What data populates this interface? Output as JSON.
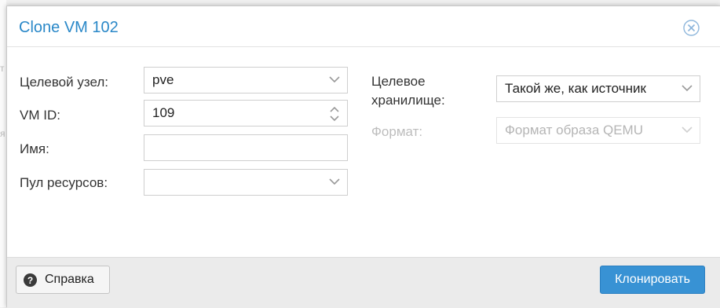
{
  "background": {
    "glyph_top": "т",
    "glyph_mid": "я"
  },
  "dialog": {
    "title": "Clone VM 102",
    "accent_color": "#2a88c8",
    "close_icon": "close-circle-icon"
  },
  "form": {
    "target_node": {
      "label": "Целевой узел:",
      "value": "pve"
    },
    "vm_id": {
      "label": "VM ID:",
      "value": "109"
    },
    "name": {
      "label": "Имя:",
      "value": ""
    },
    "resource_pool": {
      "label": "Пул ресурсов:",
      "value": ""
    },
    "target_storage": {
      "label_line1": "Целевое",
      "label_line2": "хранилище:",
      "value": "Такой же, как источник"
    },
    "format": {
      "label": "Формат:",
      "value": "Формат образа QEMU",
      "disabled": true
    }
  },
  "footer": {
    "help_label": "Справка",
    "clone_label": "Клонировать",
    "primary_color": "#3892d4"
  }
}
